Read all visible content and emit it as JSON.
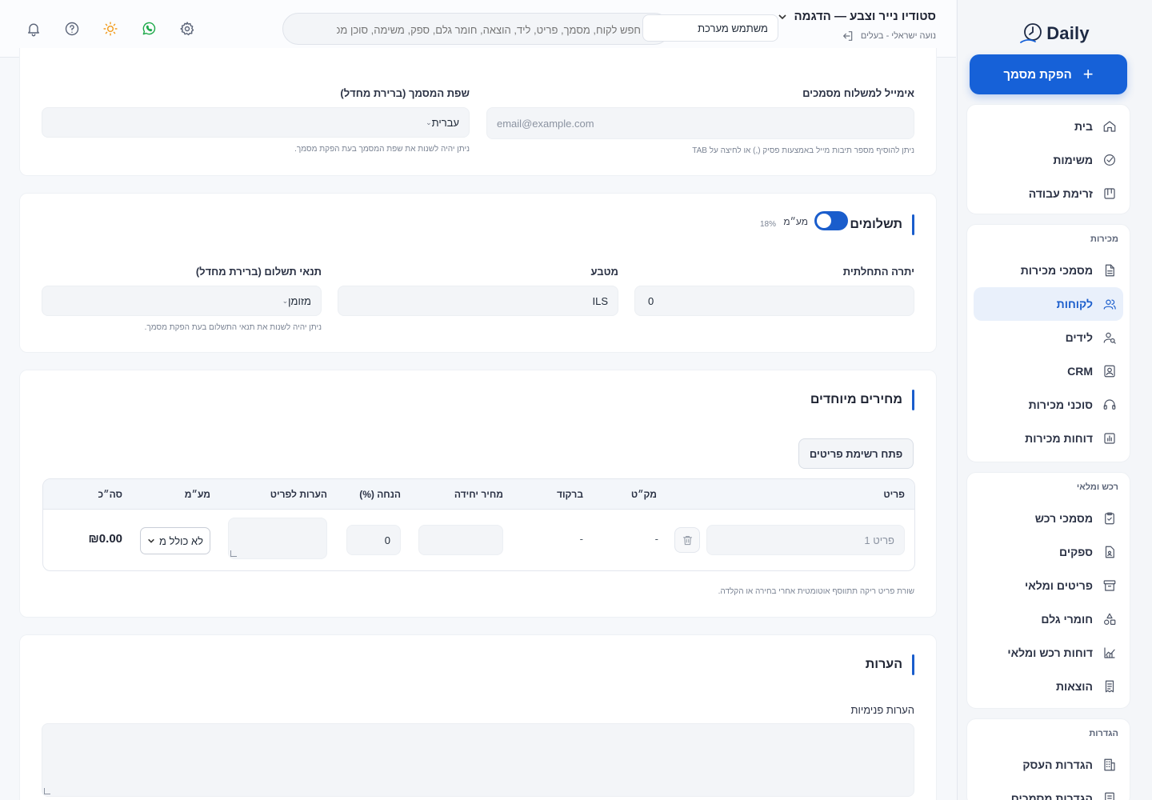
{
  "brand": {
    "logo_text": "Daily"
  },
  "sidebar": {
    "create_button": "הפקת מסמך",
    "main_items": [
      {
        "label": "בית",
        "icon": "home-icon"
      },
      {
        "label": "משימות",
        "icon": "check-circle-icon"
      },
      {
        "label": "זרימת עבודה",
        "icon": "kanban-icon"
      }
    ],
    "sales": {
      "title": "מכירות",
      "items": [
        {
          "label": "מסמכי מכירות",
          "icon": "document-icon"
        },
        {
          "label": "לקוחות",
          "icon": "users-icon"
        },
        {
          "label": "לידים",
          "icon": "user-search-icon"
        },
        {
          "label": "CRM",
          "icon": "contact-card-icon"
        },
        {
          "label": "סוכני מכירות",
          "icon": "headset-icon"
        },
        {
          "label": "דוחות מכירות",
          "icon": "bar-chart-icon"
        }
      ]
    },
    "purchases": {
      "title": "רכש ומלאי",
      "items": [
        {
          "label": "מסמכי רכש",
          "icon": "clipboard-check-icon"
        },
        {
          "label": "ספקים",
          "icon": "supplier-doc-icon"
        },
        {
          "label": "פריטים ומלאי",
          "icon": "archive-icon"
        },
        {
          "label": "חומרי גלם",
          "icon": "shapes-icon"
        },
        {
          "label": "דוחות רכש ומלאי",
          "icon": "line-chart-icon"
        },
        {
          "label": "הוצאות",
          "icon": "receipt-icon"
        }
      ]
    },
    "settings": {
      "title": "הגדרות",
      "items": [
        {
          "label": "הגדרות העסק",
          "icon": "building-icon"
        },
        {
          "label": "הגדרות מסמכים",
          "icon": "doc-settings-icon"
        }
      ]
    }
  },
  "header": {
    "business_name": "סטודיו נייר וצבע — הדגמה",
    "user_line": "נועה ישראלי - בעלים",
    "search_placeholder": "חפש לקוח, מסמך, פריט, ליד, הוצאה, חומר גלם, ספק, משימה, סוכן מכירות...",
    "system_user": "משתמש מערכת"
  },
  "email_section": {
    "email_label": "אימייל למשלוח מסמכים",
    "email_placeholder": "email@example.com",
    "email_hint": "ניתן להוסיף מספר תיבות מייל באמצעות פסיק (,) או לחיצה על TAB",
    "lang_label": "שפת המסמך (ברירת מחדל)",
    "lang_value": "עברית",
    "lang_hint": "ניתן יהיה לשנות את שפת המסמך בעת הפקת מסמך."
  },
  "payments": {
    "title": "תשלומים",
    "vat_label": "מע״מ",
    "vat_rate": "18%",
    "vat_enabled": true,
    "opening_balance_label": "יתרה התחלתית",
    "opening_balance_value": "0",
    "currency_label": "מטבע",
    "currency_value": "ILS",
    "terms_label": "תנאי תשלום (ברירת מחדל)",
    "terms_value": "מזומן",
    "terms_hint": "ניתן יהיה לשנות את תנאי התשלום בעת הפקת מסמך."
  },
  "special_prices": {
    "title": "מחירים מיוחדים",
    "open_items_button": "פתח רשימת פריטים",
    "columns": [
      "פריט",
      "מק״ט",
      "ברקוד",
      "מחיר יחידה",
      "הנחה (%)",
      "הערות לפריט",
      "מע״מ",
      "סה״כ"
    ],
    "row": {
      "item_placeholder": "פריט 1",
      "sku": "-",
      "barcode": "-",
      "unit_price": "",
      "discount": "0",
      "notes": "",
      "vat_option": "לא כולל מ",
      "total": "₪0.00"
    },
    "hint": "שורת פריט ריקה תתווסף אוטומטית אחרי בחירה או הקלדה."
  },
  "notes": {
    "title": "הערות",
    "internal_label": "הערות פנימיות"
  },
  "colors": {
    "accent": "#1661d8",
    "active_bg": "#e9f0fb",
    "whatsapp": "#1faa4b",
    "sun": "#f29a1b"
  }
}
